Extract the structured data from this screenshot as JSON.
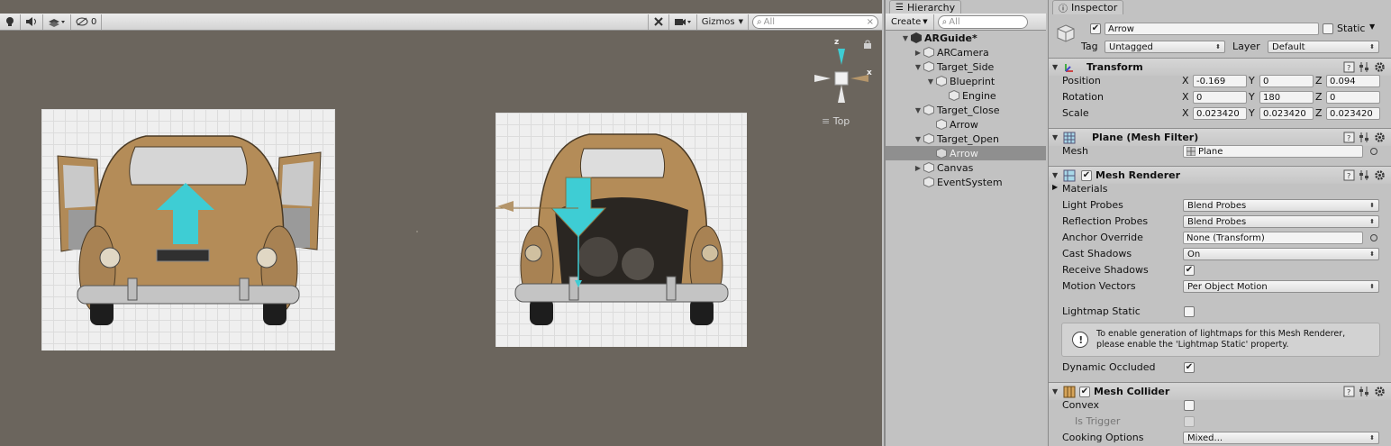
{
  "scene": {
    "toolbar": {
      "gizmos_label": "Gizmos",
      "search_placeholder": "All",
      "visibility_count": "0"
    },
    "view_label": "Top",
    "gizmo_axes": {
      "z": "z",
      "x": "x"
    },
    "colors": {
      "background": "#6b655d",
      "arrow_cyan": "#3ecdd4",
      "car_tan": "#b48c58"
    }
  },
  "hierarchy": {
    "tab": "Hierarchy",
    "create_label": "Create",
    "search_placeholder": "All",
    "root": "ARGuide*",
    "items": [
      {
        "label": "ARCamera",
        "depth": 1,
        "expanded": false,
        "has_children": true
      },
      {
        "label": "Target_Side",
        "depth": 1,
        "expanded": true,
        "has_children": true
      },
      {
        "label": "Blueprint",
        "depth": 2,
        "expanded": true,
        "has_children": true
      },
      {
        "label": "Engine",
        "depth": 3,
        "expanded": false,
        "has_children": false
      },
      {
        "label": "Target_Close",
        "depth": 1,
        "expanded": true,
        "has_children": true
      },
      {
        "label": "Arrow",
        "depth": 2,
        "expanded": false,
        "has_children": false
      },
      {
        "label": "Target_Open",
        "depth": 1,
        "expanded": true,
        "has_children": true
      },
      {
        "label": "Arrow",
        "depth": 2,
        "expanded": false,
        "has_children": false,
        "selected": true
      },
      {
        "label": "Canvas",
        "depth": 1,
        "expanded": false,
        "has_children": true
      },
      {
        "label": "EventSystem",
        "depth": 1,
        "expanded": false,
        "has_children": false
      }
    ]
  },
  "inspector": {
    "tab": "Inspector",
    "object_name": "Arrow",
    "static_label": "Static",
    "tag_label": "Tag",
    "tag_value": "Untagged",
    "layer_label": "Layer",
    "layer_value": "Default",
    "transform": {
      "title": "Transform",
      "position_label": "Position",
      "rotation_label": "Rotation",
      "scale_label": "Scale",
      "position": {
        "x": "-0.169",
        "y": "0",
        "z": "0.094"
      },
      "rotation": {
        "x": "0",
        "y": "180",
        "z": "0"
      },
      "scale": {
        "x": "0.023420",
        "y": "0.023420",
        "z": "0.023420"
      }
    },
    "mesh_filter": {
      "title": "Plane (Mesh Filter)",
      "mesh_label": "Mesh",
      "mesh_value": "Plane"
    },
    "mesh_renderer": {
      "title": "Mesh Renderer",
      "materials_label": "Materials",
      "light_probes_label": "Light Probes",
      "light_probes_value": "Blend Probes",
      "reflection_probes_label": "Reflection Probes",
      "reflection_probes_value": "Blend Probes",
      "anchor_override_label": "Anchor Override",
      "anchor_override_value": "None (Transform)",
      "cast_shadows_label": "Cast Shadows",
      "cast_shadows_value": "On",
      "receive_shadows_label": "Receive Shadows",
      "motion_vectors_label": "Motion Vectors",
      "motion_vectors_value": "Per Object Motion",
      "lightmap_static_label": "Lightmap Static",
      "info_line1": "To enable generation of lightmaps for this Mesh Renderer,",
      "info_line2": "please enable the 'Lightmap Static' property.",
      "dynamic_occluded_label": "Dynamic Occluded"
    },
    "mesh_collider": {
      "title": "Mesh Collider",
      "convex_label": "Convex",
      "is_trigger_label": "Is Trigger",
      "cooking_options_label": "Cooking Options",
      "cooking_options_value": "Mixed..."
    }
  }
}
